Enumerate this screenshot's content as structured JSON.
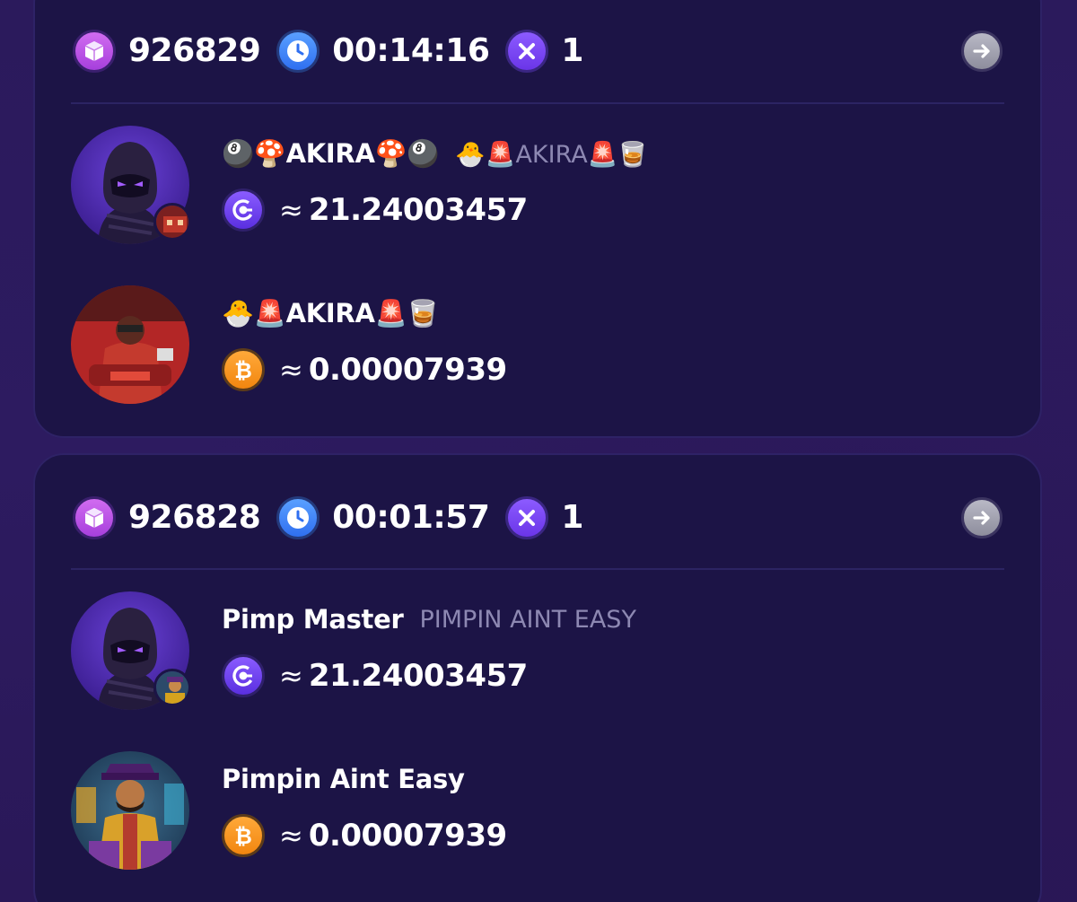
{
  "rounds": [
    {
      "block_number": "926829",
      "time": "00:14:16",
      "multiplier": "1",
      "players": [
        {
          "name": "🎱🍄AKIRA🍄🎱",
          "subtitle": "🐣🚨AKIRA🚨🥃",
          "currency_icon": "g-token-icon",
          "approx": "≈",
          "amount": "21.24003457"
        },
        {
          "name": "🐣🚨AKIRA🚨🥃",
          "subtitle": "",
          "currency_icon": "bitcoin-icon",
          "approx": "≈",
          "amount": "0.00007939"
        }
      ]
    },
    {
      "block_number": "926828",
      "time": "00:01:57",
      "multiplier": "1",
      "players": [
        {
          "name": "Pimp Master",
          "subtitle": "PIMPIN AINT EASY",
          "currency_icon": "g-token-icon",
          "approx": "≈",
          "amount": "21.24003457"
        },
        {
          "name": "Pimpin Aint Easy",
          "subtitle": "",
          "currency_icon": "bitcoin-icon",
          "approx": "≈",
          "amount": "0.00007939"
        }
      ]
    }
  ],
  "colors": {
    "background": "#2b1a5c",
    "card": "#1c1446",
    "block_badge": "#c05ae8",
    "clock_badge": "#3f83f7",
    "multiplier_badge": "#7b47f5",
    "btc": "#f7931a",
    "muted_text": "#8d88b2"
  }
}
